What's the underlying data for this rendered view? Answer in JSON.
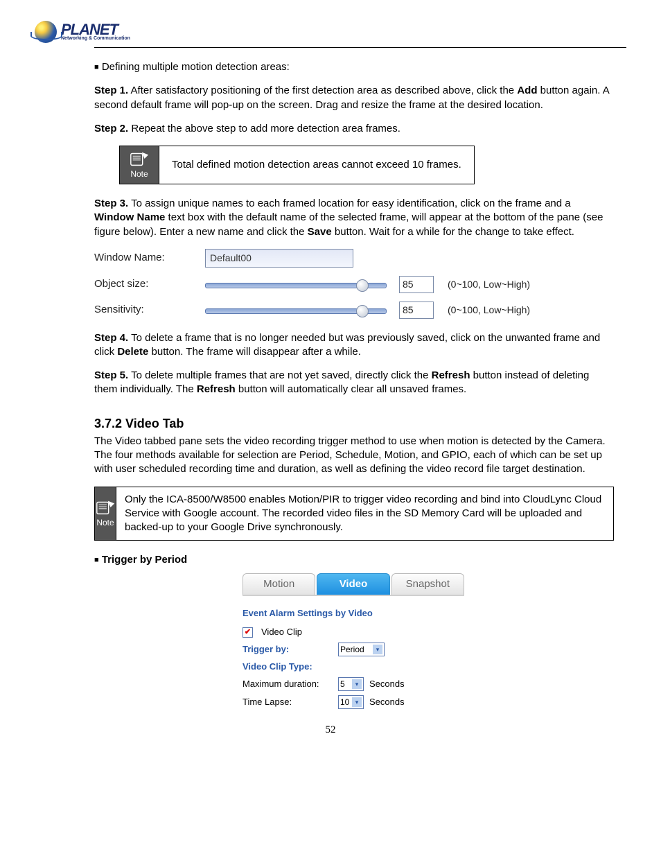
{
  "logo": {
    "brand": "PLANET",
    "tagline": "Networking & Communication"
  },
  "intro_bullet": "Defining multiple motion detection areas:",
  "step1": {
    "label": "Step 1.",
    "text_a": " After satisfactory positioning of the first detection area as described above, click the ",
    "bold_a": "Add",
    "text_b": " button again. A second default frame will pop-up on the screen. Drag and resize the frame at the desired location."
  },
  "step2": {
    "label": "Step 2.",
    "text": " Repeat the above step to add more detection area frames."
  },
  "note1": {
    "label": "Note",
    "text": "Total defined motion detection areas cannot exceed 10 frames."
  },
  "step3": {
    "label": "Step 3.",
    "text_a": " To assign unique names to each framed location for easy identification, click on the frame and a ",
    "bold_a": "Window Name",
    "text_b": " text box with the default name of the selected frame, will appear at the bottom of the pane (see figure below). Enter a new name and click the ",
    "bold_b": "Save",
    "text_c": " button. Wait for a while for the change to take effect."
  },
  "fig1": {
    "window_name_label": "Window Name:",
    "window_name_value": "Default00",
    "object_size_label": "Object size:",
    "object_size_value": "85",
    "object_size_hint": "(0~100, Low~High)",
    "sensitivity_label": "Sensitivity:",
    "sensitivity_value": "85",
    "sensitivity_hint": "(0~100, Low~High)"
  },
  "step4": {
    "label": "Step 4.",
    "text_a": " To delete a frame that is no longer needed but was previously saved, click on the unwanted frame and click ",
    "bold_a": "Delete",
    "text_b": " button. The frame will disappear after a while."
  },
  "step5": {
    "label": "Step 5.",
    "text_a": " To delete multiple frames that are not yet saved, directly click the ",
    "bold_a": "Refresh",
    "text_b": " button instead of deleting them individually. The ",
    "bold_b": "Refresh",
    "text_c": " button will automatically clear all unsaved frames."
  },
  "section_heading": "3.7.2 Video Tab",
  "section_intro": "The Video tabbed pane sets the video recording trigger method to use when motion is detected by the Camera. The four methods available for selection are Period, Schedule, Motion, and GPIO, each of which can be set up with user scheduled recording time and duration, as well as defining the video record file target destination.",
  "note2": {
    "label": "Note",
    "text": "Only the ICA-8500/W8500 enables Motion/PIR to trigger video recording and bind into CloudLync Cloud Service with Google account. The recorded video files in the SD Memory Card will be uploaded and backed-up to your Google Drive synchronously."
  },
  "trigger_heading": "Trigger by Period",
  "tabs": {
    "motion": "Motion",
    "video": "Video",
    "snapshot": "Snapshot"
  },
  "panel": {
    "title": "Event Alarm Settings by Video",
    "video_clip_label": "Video Clip",
    "trigger_by_label": "Trigger by:",
    "trigger_by_value": "Period",
    "clip_type_label": "Video Clip Type:",
    "max_dur_label": "Maximum duration:",
    "max_dur_value": "5",
    "max_dur_unit": "Seconds",
    "time_lapse_label": "Time Lapse:",
    "time_lapse_value": "10",
    "time_lapse_unit": "Seconds"
  },
  "page_number": "52"
}
